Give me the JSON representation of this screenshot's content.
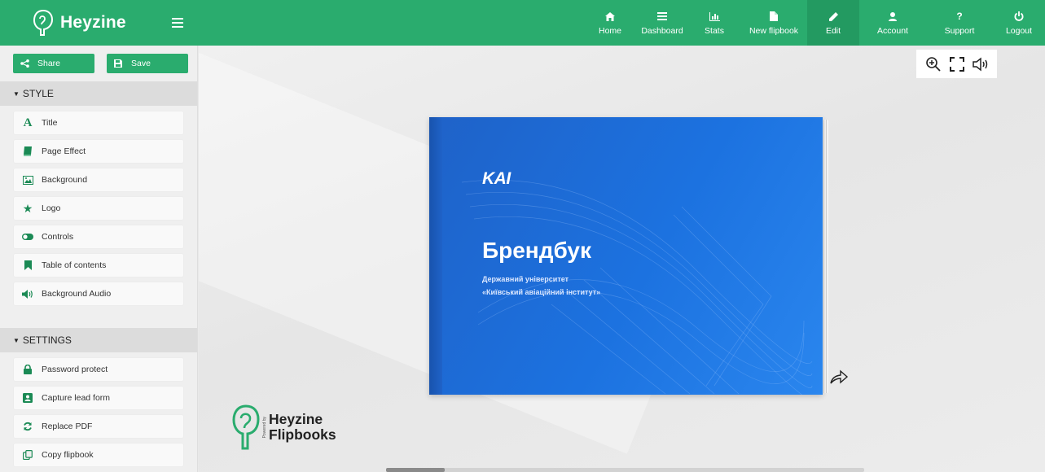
{
  "brand": {
    "name": "Heyzine"
  },
  "nav": [
    {
      "label": "Home",
      "icon": "home-icon"
    },
    {
      "label": "Dashboard",
      "icon": "list-icon"
    },
    {
      "label": "Stats",
      "icon": "chart-icon"
    },
    {
      "label": "New flipbook",
      "icon": "file-icon"
    },
    {
      "label": "Edit",
      "icon": "pencil-icon",
      "active": true
    },
    {
      "label": "Account",
      "icon": "user-icon"
    },
    {
      "label": "Support",
      "icon": "question-icon"
    },
    {
      "label": "Logout",
      "icon": "power-icon"
    }
  ],
  "sidebar": {
    "share_label": "Share",
    "save_label": "Save",
    "style_section": "STYLE",
    "style_items": [
      {
        "label": "Title",
        "icon": "title-icon"
      },
      {
        "label": "Page Effect",
        "icon": "book-icon"
      },
      {
        "label": "Background",
        "icon": "image-icon"
      },
      {
        "label": "Logo",
        "icon": "star-icon"
      },
      {
        "label": "Controls",
        "icon": "toggle-icon"
      },
      {
        "label": "Table of contents",
        "icon": "bookmark-icon"
      },
      {
        "label": "Background Audio",
        "icon": "volume-icon"
      }
    ],
    "settings_section": "SETTINGS",
    "settings_items": [
      {
        "label": "Password protect",
        "icon": "lock-icon"
      },
      {
        "label": "Capture lead form",
        "icon": "form-icon"
      },
      {
        "label": "Replace PDF",
        "icon": "refresh-icon"
      },
      {
        "label": "Copy flipbook",
        "icon": "copy-icon"
      }
    ]
  },
  "cover": {
    "logo_text": "KAI",
    "title": "Брендбук",
    "subtitle_line1": "Державний університет",
    "subtitle_line2": "«Київський авіаційний інститут»"
  },
  "footer": {
    "powered_by": "Powered by",
    "line1": "Heyzine",
    "line2": "Flipbooks"
  },
  "colors": {
    "accent": "#2aac6e",
    "cover_blue": "#1c72e0"
  }
}
